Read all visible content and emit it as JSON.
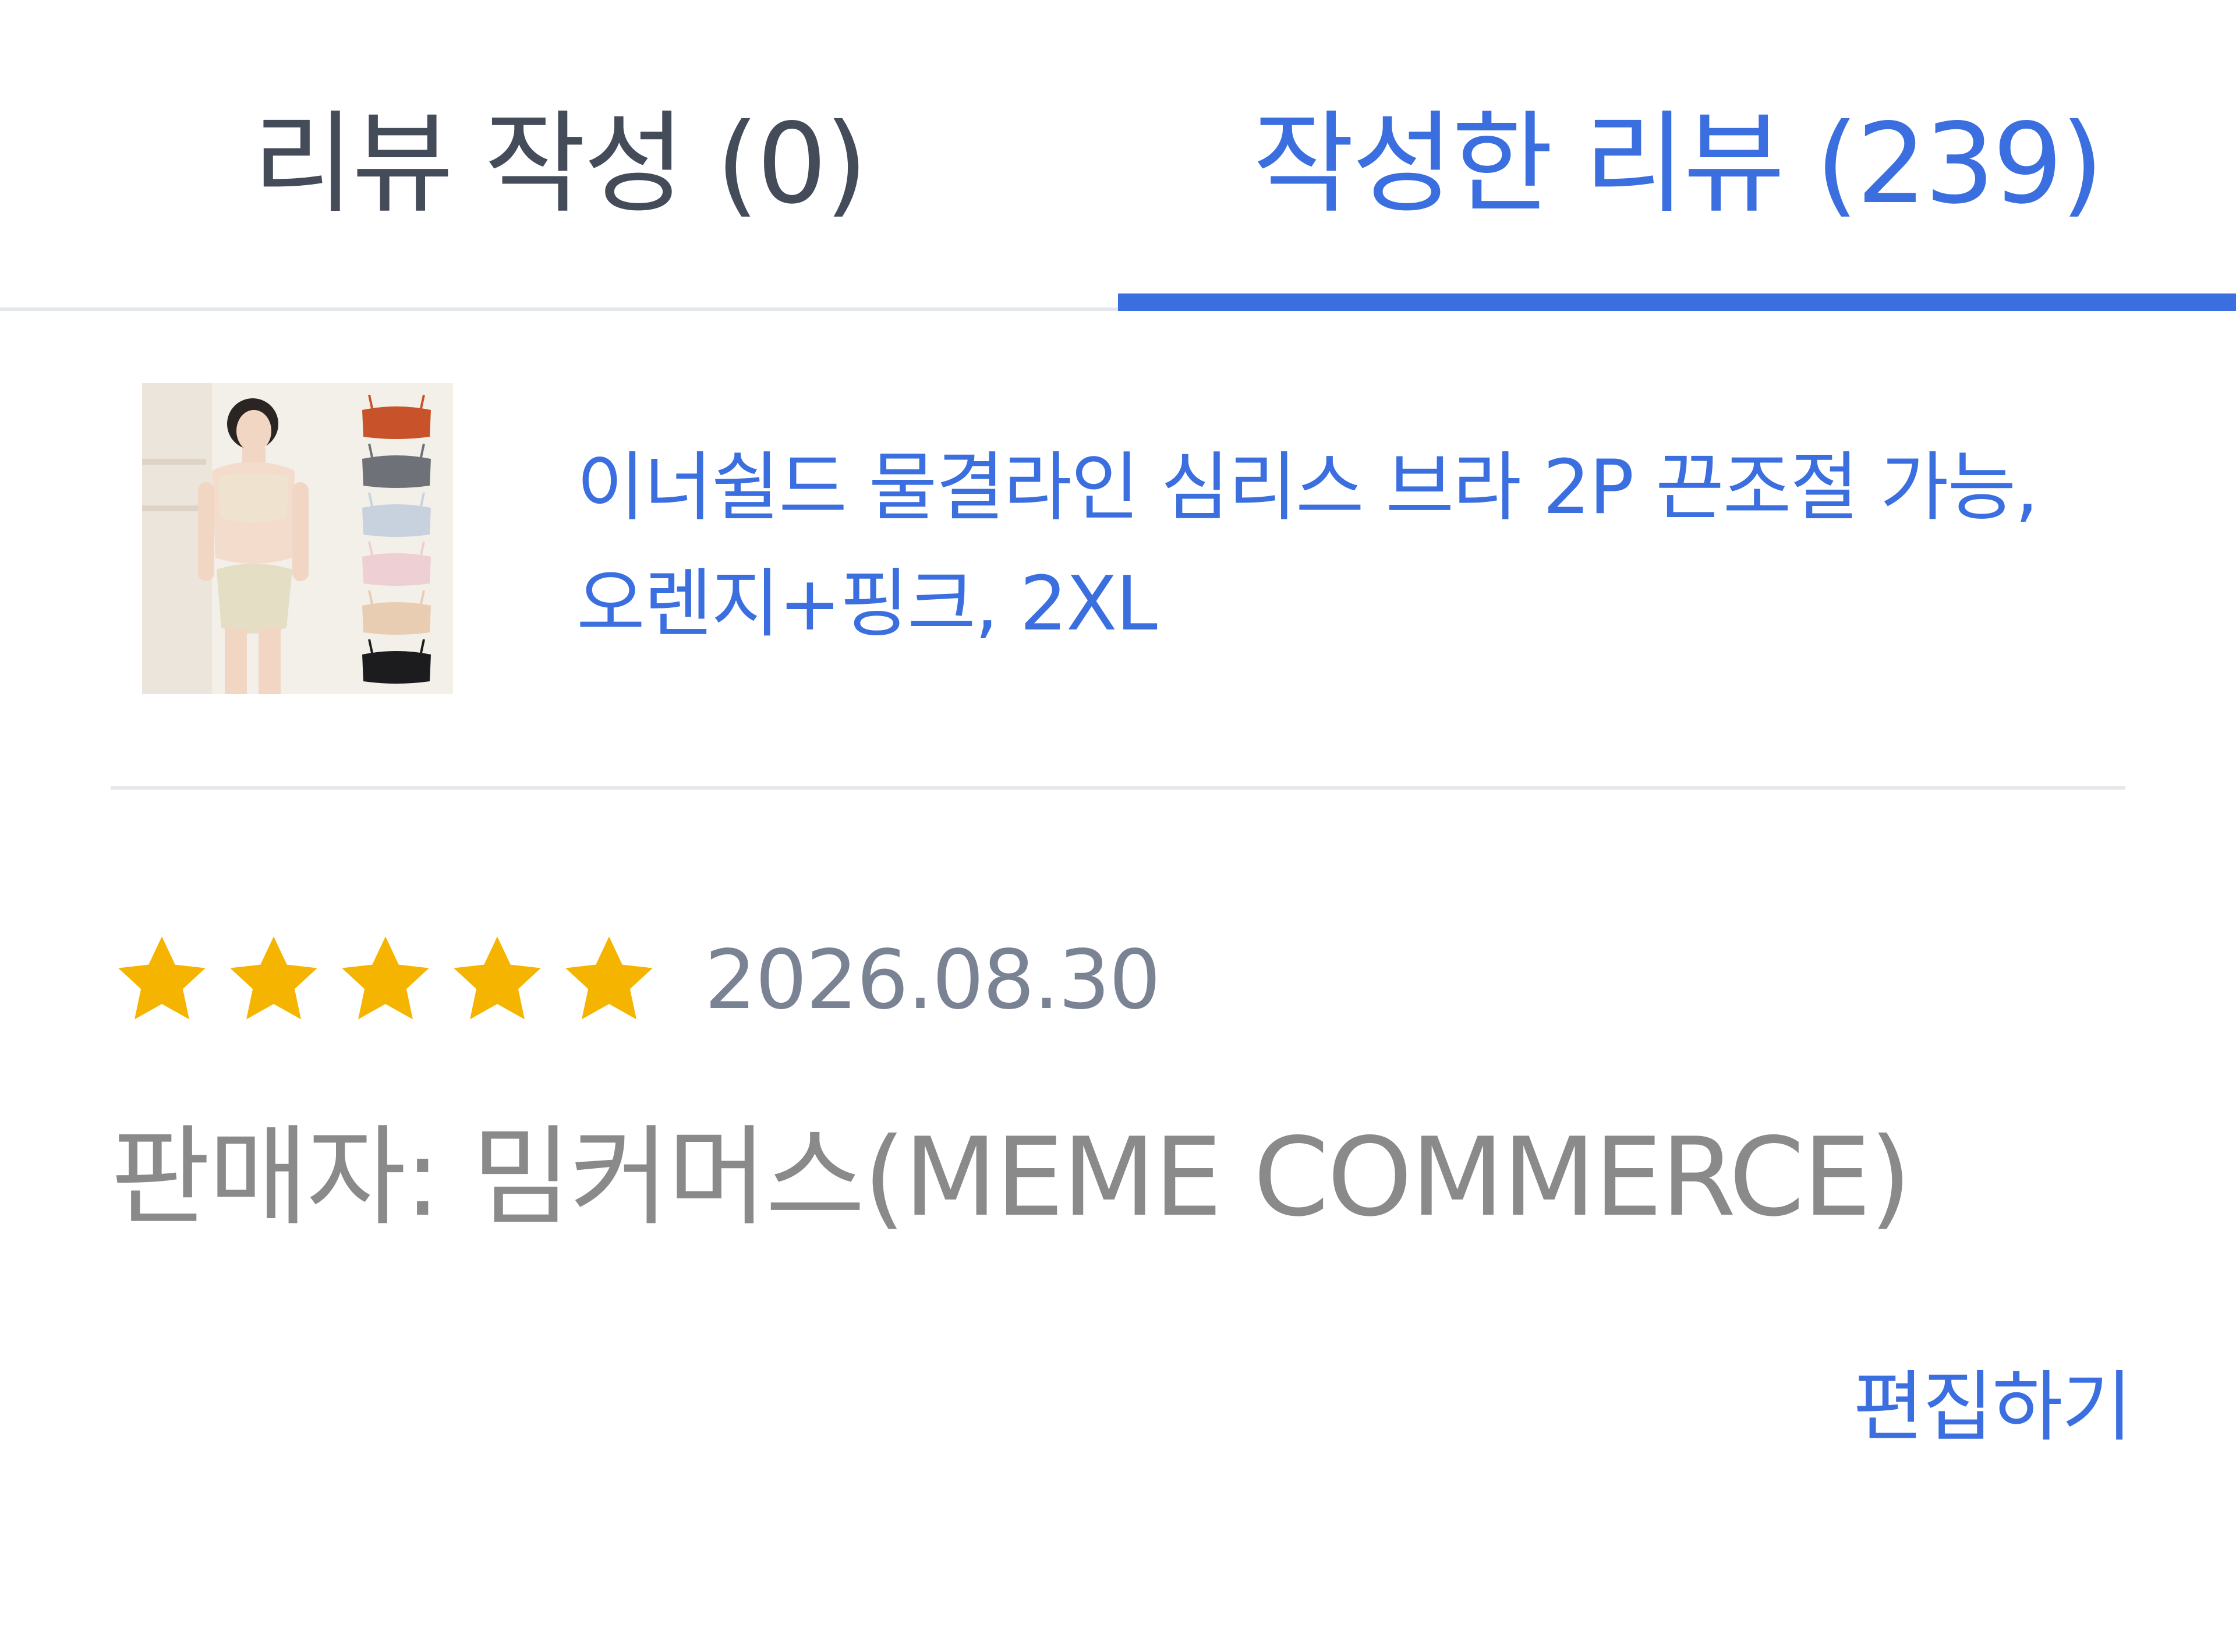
{
  "tabs": {
    "write_label": "리뷰 작성 (0)",
    "written_label": "작성한 리뷰 (239)",
    "active": "written"
  },
  "product": {
    "name": "이너쉴드 물결라인 심리스 브라 2P 끈조절 가능, 오렌지+핑크, 2XL",
    "thumbnail_swatches": [
      "#c8532a",
      "#6e7178",
      "#c7d2de",
      "#eecfd3",
      "#e9cdb2",
      "#1c1c1e"
    ]
  },
  "review": {
    "rating": 5,
    "rating_max": 5,
    "date": "2026.08.30",
    "seller": "판매자: 밈커머스(MEME COMMERCE)",
    "edit_label": "편집하기"
  },
  "colors": {
    "accent": "#3b6fe0",
    "star": "#f5b400",
    "inactive_tab": "#454c59",
    "meta_text": "#7a8393",
    "seller_text": "#8a8a8a"
  }
}
